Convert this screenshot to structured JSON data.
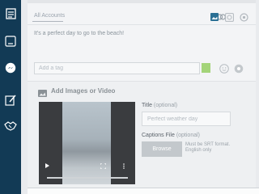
{
  "sidebar": {
    "icons": [
      "document-icon",
      "upload-icon",
      "messenger-icon",
      "compose-icon",
      "handshake-icon"
    ]
  },
  "composer": {
    "account_tab": "All Accounts",
    "post_text": "It's a perfect day to go to the beach!",
    "toolbar_icons": [
      "link-icon",
      "image-icon",
      "clock-icon",
      "settings-icon"
    ],
    "tag_placeholder": "Add a tag"
  },
  "media": {
    "heading": "Add Images or Video",
    "title_label": "Title",
    "title_optional": "(optional)",
    "title_placeholder": "Perfect weather day",
    "captions_label": "Captions File",
    "captions_optional": "(optional)",
    "browse_label": "Browse",
    "captions_hint": "Must be SRT format. English only"
  },
  "colors": {
    "sidebar": "#123a55",
    "tag_add": "#a4d479",
    "toolbar_active": "#2a6f94"
  }
}
